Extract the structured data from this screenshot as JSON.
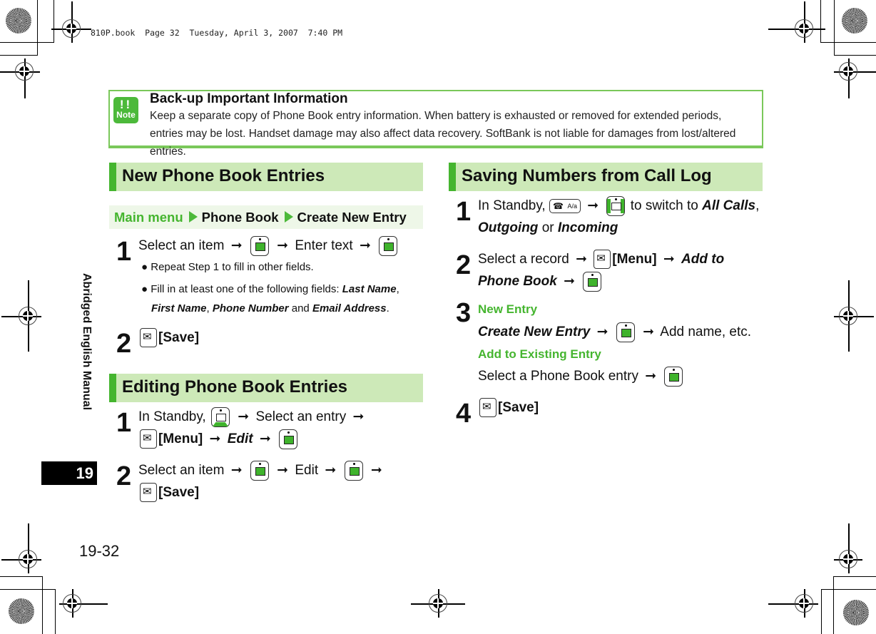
{
  "print_header": "810P.book  Page 32  Tuesday, April 3, 2007  7:40 PM",
  "note": {
    "icon_label": "Note",
    "icon_bang": "!!",
    "title": "Back-up Important Information",
    "body": "Keep a separate copy of Phone Book entry information. When battery is exhausted or removed for extended periods, entries may be lost. Handset damage may also affect data recovery. SoftBank is not liable for damages from lost/altered entries."
  },
  "sidebar": {
    "label": "Abridged English Manual",
    "chapter": "19",
    "page_number": "19-32"
  },
  "colors": {
    "accent": "#45b52f",
    "section_bg": "#cde9b8",
    "note_border": "#7ac85a"
  },
  "sections": {
    "new_entries": {
      "title": "New Phone Book Entries",
      "breadcrumb": {
        "item1": "Main menu",
        "item2": "Phone Book",
        "item3": "Create New Entry"
      },
      "step1": {
        "num": "1",
        "a": "Select an item",
        "b": "Enter text"
      },
      "bullets": {
        "b1": "Repeat Step 1 to fill in other fields.",
        "b2_prefix": "Fill in at least one of the following fields: ",
        "f1": "Last Name",
        "f2": "First Name",
        "f3": "Phone Number",
        "and": " and ",
        "f4": "Email Address"
      },
      "step2": {
        "num": "2",
        "label": "[Save]"
      }
    },
    "editing": {
      "title": "Editing Phone Book Entries",
      "step1": {
        "num": "1",
        "a": "In Standby,",
        "b": "Select an entry",
        "menu": "[Menu]",
        "edit": "Edit"
      },
      "step2": {
        "num": "2",
        "a": "Select an item",
        "b": "Edit",
        "save": "[Save]"
      }
    },
    "call_log": {
      "title": "Saving Numbers from Call Log",
      "step1": {
        "num": "1",
        "a": "In Standby,",
        "b": "to switch to",
        "opt1": "All Calls",
        "opt2": "Outgoing",
        "or": "or",
        "opt3": "Incoming",
        "key_label": "A/a"
      },
      "step2": {
        "num": "2",
        "a": "Select a record",
        "menu": "[Menu]",
        "add1": "Add to",
        "add2": "Phone Book"
      },
      "step3": {
        "num": "3",
        "new_label": "New Entry",
        "create": "Create New Entry",
        "add_name": "Add name, etc.",
        "existing_label": "Add to Existing Entry",
        "select": "Select a Phone Book entry"
      },
      "step4": {
        "num": "4",
        "label": "[Save]"
      }
    }
  },
  "arrow": "➞"
}
